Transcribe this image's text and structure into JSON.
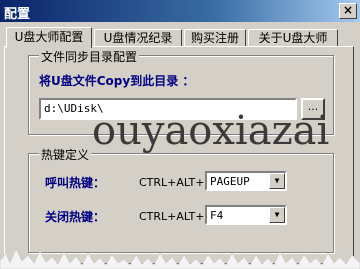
{
  "window": {
    "title": "配置",
    "close_glyph": "×"
  },
  "tabs": [
    {
      "label": "U盘大师配置",
      "active": true
    },
    {
      "label": "U盘情况纪录",
      "active": false
    },
    {
      "label": "购买注册",
      "active": false
    },
    {
      "label": "关于U盘大师",
      "active": false
    }
  ],
  "sync_group": {
    "title": "文件同步目录配置",
    "prompt": "将U盘文件Copy到此目录 ：",
    "path_value": "d:\\UDisk\\",
    "browse_label": "..."
  },
  "hotkey_group": {
    "title": "热键定义",
    "call": {
      "label": "呼叫热键：",
      "modifier": "CTRL+ALT+",
      "key": "PAGEUP"
    },
    "close": {
      "label": "关闭热键：",
      "modifier": "CTRL+ALT+",
      "key": "F4"
    }
  },
  "watermark": "ouyaoxiazai"
}
